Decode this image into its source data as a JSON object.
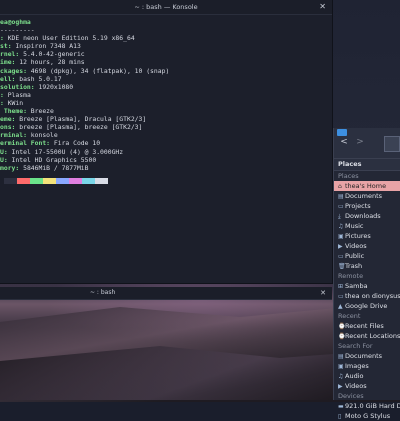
{
  "konsole": {
    "title": "~ : bash — Konsole",
    "lines": [
      {
        "key": "",
        "value": "ea@oghma"
      },
      {
        "key": "",
        "value": "---------"
      },
      {
        "key": ":",
        "value": " KDE neon User Edition 5.19 x86_64"
      },
      {
        "key": "st:",
        "value": " Inspiron 7348 A13"
      },
      {
        "key": "rnel:",
        "value": " 5.4.0-42-generic"
      },
      {
        "key": "ime:",
        "value": " 12 hours, 28 mins"
      },
      {
        "key": "ckages:",
        "value": " 4698 (dpkg), 34 (flatpak), 10 (snap)"
      },
      {
        "key": "ell:",
        "value": " bash 5.0.17"
      },
      {
        "key": "solution:",
        "value": " 1920x1080"
      },
      {
        "key": ":",
        "value": " Plasma"
      },
      {
        "key": ":",
        "value": " KWin"
      },
      {
        "key": " Theme:",
        "value": " Breeze"
      },
      {
        "key": "eme:",
        "value": " Breeze [Plasma], Dracula [GTK2/3]"
      },
      {
        "key": "ons:",
        "value": " breeze [Plasma], breeze [GTK2/3]"
      },
      {
        "key": "rminal:",
        "value": " konsole"
      },
      {
        "key": "erminal Font:",
        "value": " Fira Code 10"
      },
      {
        "key": "U:",
        "value": " Intel i7-5500U (4) @ 3.000GHz"
      },
      {
        "key": "U:",
        "value": " Intel HD Graphics 5500"
      },
      {
        "key": "mory:",
        "value": " 5846MiB / 7877MiB"
      }
    ],
    "palette": [
      "#2d3040",
      "#ff6b6b",
      "#6be38a",
      "#f3e27a",
      "#8aa8ff",
      "#e07fe0",
      "#7ad6e8",
      "#d8dce6",
      "#4a4e60",
      "#ff8787",
      "#8af0a3",
      "#fff08f",
      "#a2bbff",
      "#f59af5",
      "#9be6f3",
      "#ffffff"
    ]
  },
  "panel2": {
    "title": "~ : bash"
  },
  "dolphin": {
    "header": "Places",
    "sections": [
      {
        "title": "Places",
        "items": [
          {
            "label": "thea's Home",
            "icon": "⌂",
            "selected": true
          },
          {
            "label": "Documents",
            "icon": "▤"
          },
          {
            "label": "Projects",
            "icon": "▭"
          },
          {
            "label": "Downloads",
            "icon": "⤓"
          },
          {
            "label": "Music",
            "icon": "♫"
          },
          {
            "label": "Pictures",
            "icon": "▣"
          },
          {
            "label": "Videos",
            "icon": "▶"
          },
          {
            "label": "Public",
            "icon": "▭"
          },
          {
            "label": "Trash",
            "icon": "🗑"
          }
        ]
      },
      {
        "title": "Remote",
        "items": [
          {
            "label": "Samba",
            "icon": "⊞"
          },
          {
            "label": "thea on dionysus",
            "icon": "▭"
          },
          {
            "label": "Google Drive",
            "icon": "▲"
          }
        ]
      },
      {
        "title": "Recent",
        "items": [
          {
            "label": "Recent Files",
            "icon": "⌚"
          },
          {
            "label": "Recent Locations",
            "icon": "⌚"
          }
        ]
      },
      {
        "title": "Search For",
        "items": [
          {
            "label": "Documents",
            "icon": "▤"
          },
          {
            "label": "Images",
            "icon": "▣"
          },
          {
            "label": "Audio",
            "icon": "♫"
          },
          {
            "label": "Videos",
            "icon": "▶"
          }
        ]
      },
      {
        "title": "Devices",
        "items": [
          {
            "label": "921.0 GiB Hard Drive",
            "icon": "▬"
          },
          {
            "label": "Moto G Stylus",
            "icon": "▯"
          }
        ]
      }
    ]
  }
}
